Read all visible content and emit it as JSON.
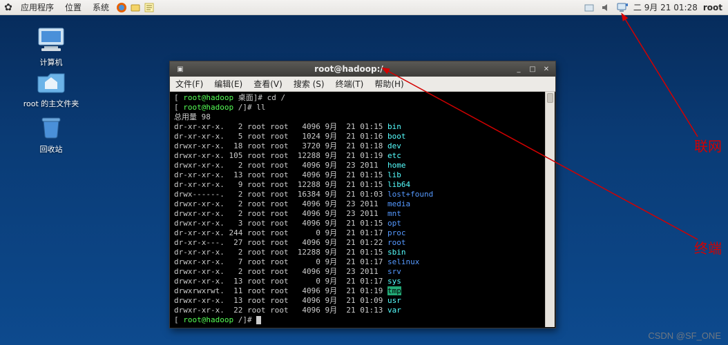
{
  "panel": {
    "menus": [
      "应用程序",
      "位置",
      "系统"
    ],
    "clock": "二  9月 21 01:28",
    "user": "root"
  },
  "desktop": {
    "computer": "计算机",
    "home": "root 的主文件夹",
    "trash": "回收站"
  },
  "terminal": {
    "title": "root@hadoop:/",
    "menus": [
      "文件(F)",
      "编辑(E)",
      "查看(V)",
      "搜索 (S)",
      "终端(T)",
      "帮助(H)"
    ],
    "prompt1_user": "root@hadoop",
    "prompt1_path": "桌面",
    "cmd1": "cd /",
    "prompt2_user": "root@hadoop",
    "prompt2_path": "/",
    "cmd2": "ll",
    "total": "总用量 98",
    "rows": [
      {
        "perm": "dr-xr-xr-x.",
        "lnk": "  2",
        "own": "root root",
        "size": "  4096",
        "mon": "9月",
        "day": "21",
        "time": "01:15",
        "name": "bin",
        "cls": "cy"
      },
      {
        "perm": "dr-xr-xr-x.",
        "lnk": "  5",
        "own": "root root",
        "size": "  1024",
        "mon": "9月",
        "day": "21",
        "time": "01:16",
        "name": "boot",
        "cls": "cy"
      },
      {
        "perm": "drwxr-xr-x.",
        "lnk": " 18",
        "own": "root root",
        "size": "  3720",
        "mon": "9月",
        "day": "21",
        "time": "01:18",
        "name": "dev",
        "cls": "cy"
      },
      {
        "perm": "drwxr-xr-x.",
        "lnk": "105",
        "own": "root root",
        "size": " 12288",
        "mon": "9月",
        "day": "21",
        "time": "01:19",
        "name": "etc",
        "cls": "cy"
      },
      {
        "perm": "drwxr-xr-x.",
        "lnk": "  2",
        "own": "root root",
        "size": "  4096",
        "mon": "9月",
        "day": "23",
        "time": "2011 ",
        "name": "home",
        "cls": "cy"
      },
      {
        "perm": "dr-xr-xr-x.",
        "lnk": " 13",
        "own": "root root",
        "size": "  4096",
        "mon": "9月",
        "day": "21",
        "time": "01:15",
        "name": "lib",
        "cls": "cy"
      },
      {
        "perm": "dr-xr-xr-x.",
        "lnk": "  9",
        "own": "root root",
        "size": " 12288",
        "mon": "9月",
        "day": "21",
        "time": "01:15",
        "name": "lib64",
        "cls": "cy"
      },
      {
        "perm": "drwx------.",
        "lnk": "  2",
        "own": "root root",
        "size": " 16384",
        "mon": "9月",
        "day": "21",
        "time": "01:03",
        "name": "lost+found",
        "cls": "bl"
      },
      {
        "perm": "drwxr-xr-x.",
        "lnk": "  2",
        "own": "root root",
        "size": "  4096",
        "mon": "9月",
        "day": "23",
        "time": "2011 ",
        "name": "media",
        "cls": "bl"
      },
      {
        "perm": "drwxr-xr-x.",
        "lnk": "  2",
        "own": "root root",
        "size": "  4096",
        "mon": "9月",
        "day": "23",
        "time": "2011 ",
        "name": "mnt",
        "cls": "bl"
      },
      {
        "perm": "drwxr-xr-x.",
        "lnk": "  3",
        "own": "root root",
        "size": "  4096",
        "mon": "9月",
        "day": "21",
        "time": "01:15",
        "name": "opt",
        "cls": "bl"
      },
      {
        "perm": "dr-xr-xr-x.",
        "lnk": "244",
        "own": "root root",
        "size": "     0",
        "mon": "9月",
        "day": "21",
        "time": "01:17",
        "name": "proc",
        "cls": "bl"
      },
      {
        "perm": "dr-xr-x---.",
        "lnk": " 27",
        "own": "root root",
        "size": "  4096",
        "mon": "9月",
        "day": "21",
        "time": "01:22",
        "name": "root",
        "cls": "bl"
      },
      {
        "perm": "dr-xr-xr-x.",
        "lnk": "  2",
        "own": "root root",
        "size": " 12288",
        "mon": "9月",
        "day": "21",
        "time": "01:15",
        "name": "sbin",
        "cls": "cy"
      },
      {
        "perm": "drwxr-xr-x.",
        "lnk": "  7",
        "own": "root root",
        "size": "     0",
        "mon": "9月",
        "day": "21",
        "time": "01:17",
        "name": "selinux",
        "cls": "bl"
      },
      {
        "perm": "drwxr-xr-x.",
        "lnk": "  2",
        "own": "root root",
        "size": "  4096",
        "mon": "9月",
        "day": "23",
        "time": "2011 ",
        "name": "srv",
        "cls": "bl"
      },
      {
        "perm": "drwxr-xr-x.",
        "lnk": " 13",
        "own": "root root",
        "size": "     0",
        "mon": "9月",
        "day": "21",
        "time": "01:17",
        "name": "sys",
        "cls": "cy"
      },
      {
        "perm": "drwxrwxrwt.",
        "lnk": " 11",
        "own": "root root",
        "size": "  4096",
        "mon": "9月",
        "day": "21",
        "time": "01:19",
        "name": "tmp",
        "cls": "hl"
      },
      {
        "perm": "drwxr-xr-x.",
        "lnk": " 13",
        "own": "root root",
        "size": "  4096",
        "mon": "9月",
        "day": "21",
        "time": "01:09",
        "name": "usr",
        "cls": "cy"
      },
      {
        "perm": "drwxr-xr-x.",
        "lnk": " 22",
        "own": "root root",
        "size": "  4096",
        "mon": "9月",
        "day": "21",
        "time": "01:13",
        "name": "var",
        "cls": "cy"
      }
    ],
    "prompt3_user": "root@hadoop",
    "prompt3_path": "/"
  },
  "annotations": {
    "network": "联网",
    "terminal": "终端"
  },
  "watermark": "CSDN @SF_ONE"
}
